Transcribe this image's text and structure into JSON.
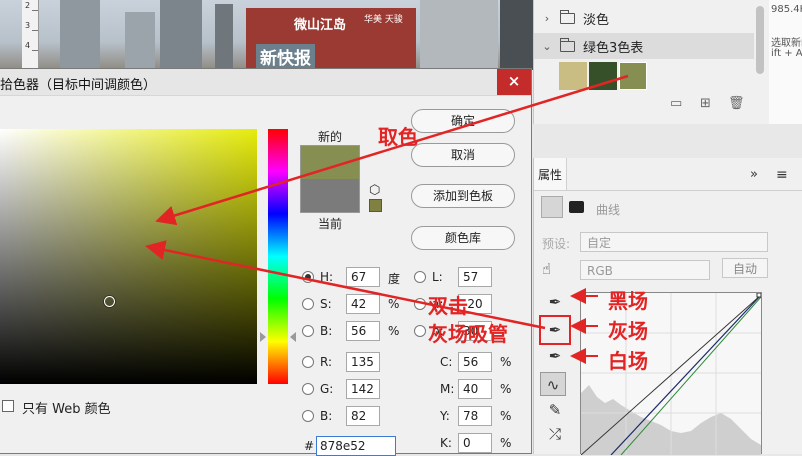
{
  "ruler": {
    "marks": [
      "2",
      "3",
      "4"
    ]
  },
  "photo": {
    "billboard_text": "新快报",
    "sign_text": "微山江岛",
    "sign_sub": "华美 天骏"
  },
  "swatches_panel": {
    "folder_pale": "淡色",
    "folder_green": "绿色3色表",
    "chips": [
      "#c9bd83",
      "#36502a",
      "#878e52"
    ]
  },
  "far_right": {
    "lines": [
      "985.4K",
      "选取新的",
      "ift + Alt"
    ]
  },
  "properties": {
    "tab": "属性",
    "title": "曲线",
    "preset_label": "预设:",
    "preset_value": "自定",
    "channel": "RGB",
    "auto_button": "自动",
    "collapse": "»",
    "menu": "≡"
  },
  "dialog": {
    "title": "拾色器（目标中间调颜色）",
    "close": "×",
    "new_label": "新的",
    "current_label": "当前",
    "new_color": "#878e52",
    "current_color": "#7b7b7b",
    "web_swatch_color": "#808040",
    "web_only_label": "只有 Web 颜色",
    "buttons": {
      "ok": "确定",
      "cancel": "取消",
      "add_swatch": "添加到色板",
      "library": "颜色库"
    },
    "fields": {
      "H": {
        "label": "H:",
        "value": "67",
        "unit": "度"
      },
      "S": {
        "label": "S:",
        "value": "42",
        "unit": "%"
      },
      "B": {
        "label": "B:",
        "value": "56",
        "unit": "%"
      },
      "R": {
        "label": "R:",
        "value": "135"
      },
      "G": {
        "label": "G:",
        "value": "142"
      },
      "Bb": {
        "label": "B:",
        "value": "82"
      },
      "L": {
        "label": "L:",
        "value": "57"
      },
      "a": {
        "label": "a:",
        "value": "-20"
      },
      "b": {
        "label": "b:",
        "value": "30"
      },
      "C": {
        "label": "C:",
        "value": "56",
        "unit": "%"
      },
      "M": {
        "label": "M:",
        "value": "40",
        "unit": "%"
      },
      "Y": {
        "label": "Y:",
        "value": "78",
        "unit": "%"
      },
      "K": {
        "label": "K:",
        "value": "0",
        "unit": "%"
      }
    },
    "hex_label": "#",
    "hex_value": "878e52"
  },
  "annotations": {
    "pick": "取色",
    "double_click": "双击",
    "gray_eyedropper": "灰场吸管",
    "black_point": "黑场",
    "gray_point": "灰场",
    "white_point": "白场",
    "color": "#e32424"
  }
}
